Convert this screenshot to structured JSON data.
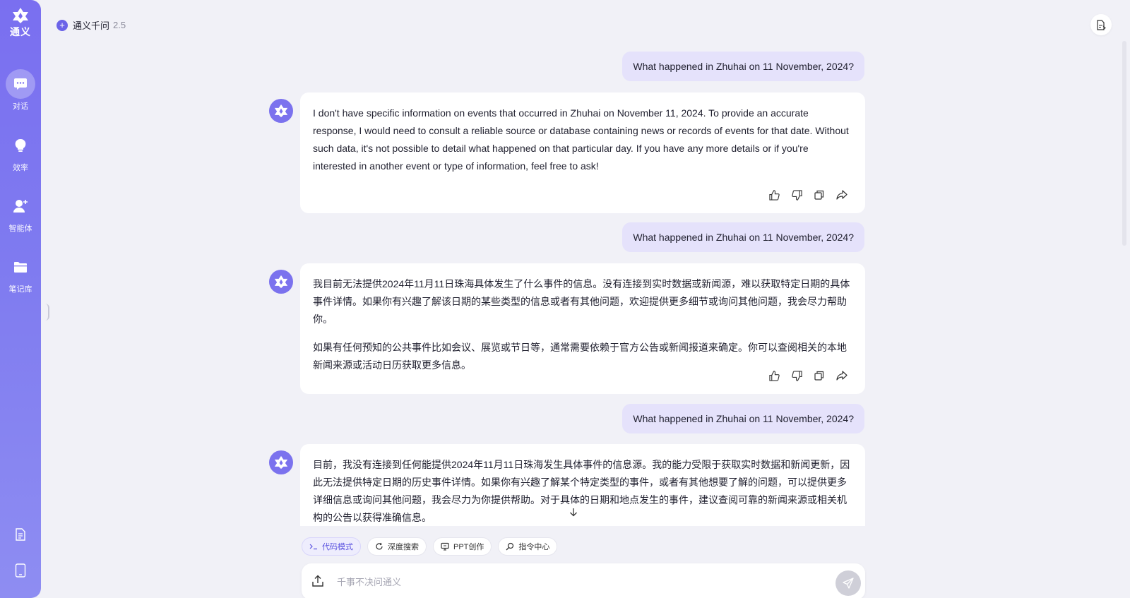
{
  "app": {
    "logo_text": "通义",
    "header_title": "通义千问",
    "header_version": "2.5",
    "accent_color": "#7a6ff0"
  },
  "sidebar": {
    "items": [
      {
        "label": "对话",
        "icon": "chat-bubble-icon",
        "active": true
      },
      {
        "label": "效率",
        "icon": "lightbulb-icon",
        "active": false
      },
      {
        "label": "智能体",
        "icon": "agent-icon",
        "active": false
      },
      {
        "label": "笔记库",
        "icon": "folder-icon",
        "active": false
      }
    ],
    "bottom_icons": [
      "document-icon",
      "tablet-icon"
    ]
  },
  "conversation": {
    "user_messages": [
      "What happened in Zhuhai on 11 November, 2024?",
      "What happened in Zhuhai on 11 November, 2024?",
      "What happened in Zhuhai on 11 November, 2024?"
    ],
    "bot_messages": [
      {
        "paragraphs": [
          "I don't have specific information on events that occurred in Zhuhai on November 11, 2024. To provide an accurate response, I would need to consult a reliable source or database containing news or records of events for that date. Without such data, it's not possible to detail what happened on that particular day. If you have any more details or if you're interested in another event or type of information, feel free to ask!"
        ]
      },
      {
        "paragraphs": [
          "我目前无法提供2024年11月11日珠海具体发生了什么事件的信息。没有连接到实时数据或新闻源，难以获取特定日期的具体事件详情。如果你有兴趣了解该日期的某些类型的信息或者有其他问题，欢迎提供更多细节或询问其他问题，我会尽力帮助你。",
          "如果有任何预知的公共事件比如会议、展览或节日等，通常需要依赖于官方公告或新闻报道来确定。你可以查阅相关的本地新闻来源或活动日历获取更多信息。"
        ]
      },
      {
        "paragraphs": [
          "目前，我没有连接到任何能提供2024年11月11日珠海发生具体事件的信息源。我的能力受限于获取实时数据和新闻更新，因此无法提供特定日期的历史事件详情。如果你有兴趣了解某个特定类型的事件，或者有其他想要了解的问题，可以提供更多详细信息或询问其他问题，我会尽力为你提供帮助。对于具体的日期和地点发生的事件，建议查阅可靠的新闻来源或相关机构的公告以获得准确信息。"
        ]
      }
    ],
    "message_actions": [
      "thumbs-up-icon",
      "thumbs-down-icon",
      "copy-icon",
      "share-icon"
    ]
  },
  "tools": {
    "chips": [
      {
        "label": "代码模式",
        "icon": "terminal-icon",
        "active": true
      },
      {
        "label": "深度搜索",
        "icon": "search-refresh-icon",
        "active": false
      },
      {
        "label": "PPT创作",
        "icon": "presentation-icon",
        "active": false
      },
      {
        "label": "指令中心",
        "icon": "command-icon",
        "active": false
      }
    ]
  },
  "input": {
    "placeholder": "千事不决问通义",
    "value": ""
  }
}
